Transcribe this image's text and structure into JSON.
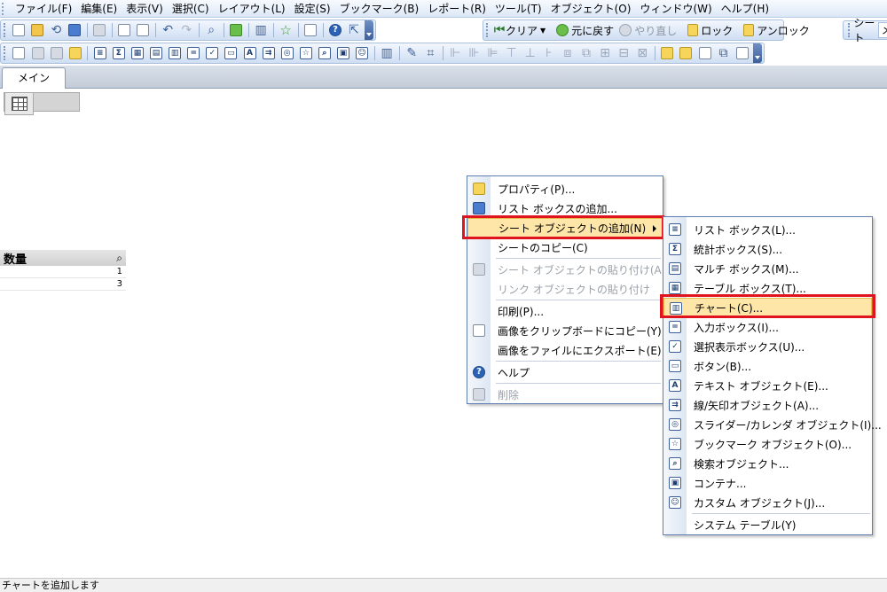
{
  "menubar": {
    "items": [
      "ファイル(F)",
      "編集(E)",
      "表示(V)",
      "選択(C)",
      "レイアウト(L)",
      "設定(S)",
      "ブックマーク(B)",
      "レポート(R)",
      "ツール(T)",
      "オブジェクト(O)",
      "ウィンドウ(W)",
      "ヘルプ(H)"
    ]
  },
  "toolbar": {
    "clear_label": "クリア",
    "back_label": "元に戻す",
    "redo_label": "やり直し",
    "lock_label": "ロック",
    "unlock_label": "アンロック",
    "sheet_label": "シート",
    "sheet_value": "メ"
  },
  "tabs": {
    "main": "メイン"
  },
  "listbox": {
    "title": "数量",
    "values": [
      "1",
      "3"
    ]
  },
  "context_menu": {
    "properties": "プロパティ(P)...",
    "add_listbox": "リスト ボックスの追加...",
    "add_sheet_object": "シート オブジェクトの追加(N)",
    "copy_sheet": "シートのコピー(C)",
    "paste_sheet_object": "シート オブジェクトの貼り付け(A)",
    "paste_link_object": "リンク オブジェクトの貼り付け",
    "print": "印刷(P)...",
    "copy_image_clipboard": "画像をクリップボードにコピー(Y)",
    "export_image_file": "画像をファイルにエクスポート(E)",
    "help": "ヘルプ",
    "delete": "削除"
  },
  "submenu": {
    "listbox": "リスト ボックス(L)...",
    "statistics": "統計ボックス(S)...",
    "multibox": "マルチ ボックス(M)...",
    "tablebox": "テーブル ボックス(T)...",
    "chart": "チャート(C)...",
    "inputbox": "入力ボックス(I)...",
    "current_selections": "選択表示ボックス(U)...",
    "button": "ボタン(B)...",
    "text_object": "テキスト オブジェクト(E)...",
    "line_arrow": "線/矢印オブジェクト(A)...",
    "slider": "スライダー/カレンダ オブジェクト(I)...",
    "bookmark": "ブックマーク オブジェクト(O)...",
    "search": "検索オブジェクト...",
    "container": "コンテナ...",
    "custom": "カスタム オブジェクト(J)...",
    "system_table": "システム テーブル(Y)"
  },
  "statusbar": {
    "text": "チャートを追加します"
  },
  "colors": {
    "highlight": "#fde6a8",
    "redbox": "#e0141f",
    "menu_border": "#5f7fb4"
  }
}
